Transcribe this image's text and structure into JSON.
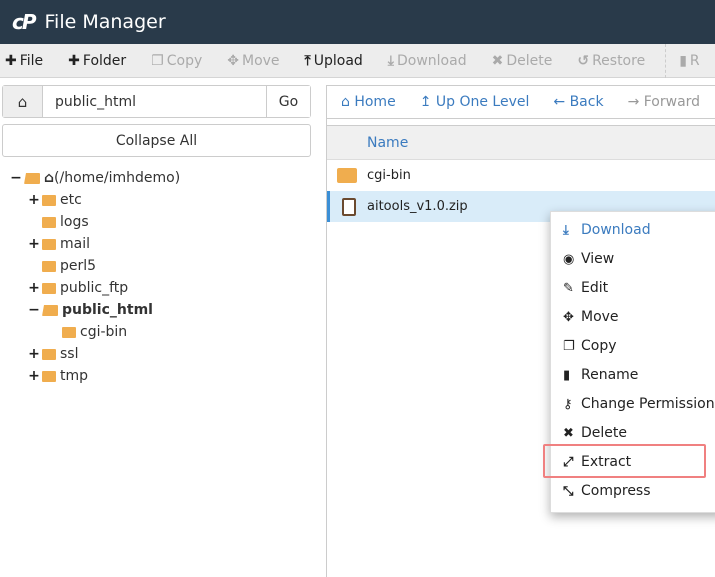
{
  "header": {
    "logo": "cP",
    "title": "File Manager"
  },
  "toolbar": [
    {
      "label": "File",
      "icon": "plus",
      "enabled": true
    },
    {
      "label": "Folder",
      "icon": "plus",
      "enabled": true
    },
    {
      "label": "Copy",
      "icon": "copy",
      "enabled": false
    },
    {
      "label": "Move",
      "icon": "move",
      "enabled": false
    },
    {
      "label": "Upload",
      "icon": "upload",
      "enabled": true
    },
    {
      "label": "Download",
      "icon": "download",
      "enabled": false
    },
    {
      "label": "Delete",
      "icon": "times",
      "enabled": false
    },
    {
      "label": "Restore",
      "icon": "undo",
      "enabled": false
    },
    {
      "label": "R",
      "icon": "file",
      "enabled": false
    }
  ],
  "path": {
    "value": "public_html",
    "go": "Go"
  },
  "collapse_all": "Collapse All",
  "tree": [
    {
      "label": "(/home/imhdemo)",
      "toggle": "−",
      "open": true,
      "home": true
    },
    {
      "label": "etc",
      "toggle": "+"
    },
    {
      "label": "logs",
      "toggle": ""
    },
    {
      "label": "mail",
      "toggle": "+"
    },
    {
      "label": "perl5",
      "toggle": ""
    },
    {
      "label": "public_ftp",
      "toggle": "+"
    },
    {
      "label": "public_html",
      "toggle": "−",
      "open": true,
      "bold": true
    },
    {
      "label": "cgi-bin",
      "toggle": ""
    },
    {
      "label": "ssl",
      "toggle": "+"
    },
    {
      "label": "tmp",
      "toggle": "+"
    }
  ],
  "nav": [
    {
      "label": "Home",
      "icon": "home"
    },
    {
      "label": "Up One Level",
      "icon": "level-up"
    },
    {
      "label": "Back",
      "icon": "arrow-left"
    },
    {
      "label": "Forward",
      "icon": "arrow-right"
    }
  ],
  "list": {
    "header": "Name",
    "rows": [
      {
        "name": "cgi-bin",
        "type": "folder"
      },
      {
        "name": "aitools_v1.0.zip",
        "type": "zip",
        "selected": true
      }
    ]
  },
  "context_menu": [
    {
      "label": "Download",
      "icon": "download"
    },
    {
      "label": "View",
      "icon": "eye"
    },
    {
      "label": "Edit",
      "icon": "pencil"
    },
    {
      "label": "Move",
      "icon": "move"
    },
    {
      "label": "Copy",
      "icon": "copy"
    },
    {
      "label": "Rename",
      "icon": "file"
    },
    {
      "label": "Change Permissions",
      "icon": "key"
    },
    {
      "label": "Delete",
      "icon": "times"
    },
    {
      "label": "Extract",
      "icon": "expand",
      "highlighted": true
    },
    {
      "label": "Compress",
      "icon": "compress"
    }
  ],
  "colors": {
    "header": "#293a4a",
    "link": "#3b7bbf",
    "folder": "#f0ad4e",
    "selected": "#d9ecf9",
    "highlight": "#f08080"
  }
}
